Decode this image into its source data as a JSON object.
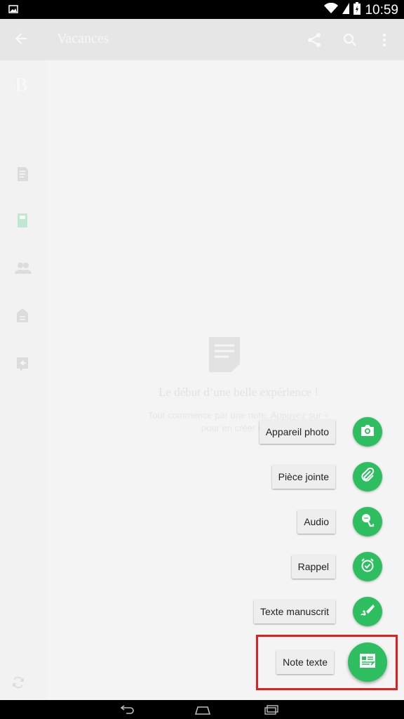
{
  "status_bar": {
    "time": "10:59"
  },
  "app_bar": {
    "title": "Vacances",
    "icons": [
      "back-arrow-icon",
      "share-icon",
      "search-icon",
      "more-vert-icon"
    ]
  },
  "sidebar": {
    "brand": "B",
    "icons": [
      "note-icon",
      "notebook-icon",
      "people-icon",
      "tag-icon",
      "shortcut-icon"
    ]
  },
  "empty_state": {
    "title": "Le début d’une belle expérience !",
    "subtitle_line1": "Tout commence par une note. Appuyez sur +",
    "subtitle_line2": "pour en créer une."
  },
  "quick_menu": [
    {
      "label": "Appareil photo",
      "icon": "camera-icon"
    },
    {
      "label": "Pièce jointe",
      "icon": "paperclip-icon"
    },
    {
      "label": "Audio",
      "icon": "microphone-icon"
    },
    {
      "label": "Rappel",
      "icon": "alarm-icon"
    },
    {
      "label": "Texte manuscrit",
      "icon": "handwriting-icon"
    },
    {
      "label": "Note texte",
      "icon": "text-note-icon"
    }
  ],
  "colors": {
    "accent": "#2dbe60",
    "highlight": "#e02020"
  }
}
